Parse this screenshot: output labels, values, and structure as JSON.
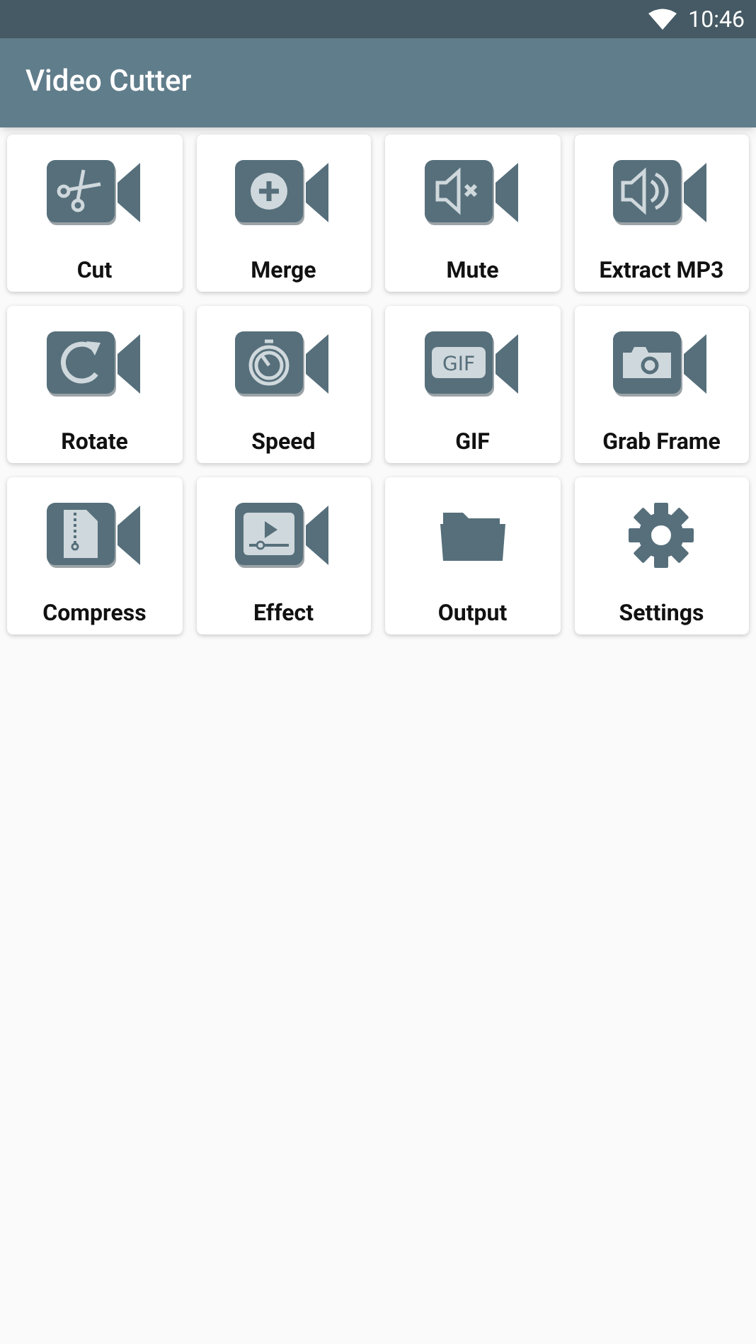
{
  "status_bar": {
    "time": "10:46"
  },
  "app_bar": {
    "title": "Video Cutter"
  },
  "tools": [
    {
      "kind": "cut",
      "label": "Cut"
    },
    {
      "kind": "merge",
      "label": "Merge"
    },
    {
      "kind": "mute",
      "label": "Mute"
    },
    {
      "kind": "extract",
      "label": "Extract MP3"
    },
    {
      "kind": "rotate",
      "label": "Rotate"
    },
    {
      "kind": "speed",
      "label": "Speed"
    },
    {
      "kind": "gif",
      "label": "GIF",
      "icon_text": "GIF"
    },
    {
      "kind": "grab",
      "label": "Grab Frame"
    },
    {
      "kind": "compress",
      "label": "Compress"
    },
    {
      "kind": "effect",
      "label": "Effect"
    },
    {
      "kind": "folder",
      "label": "Output"
    },
    {
      "kind": "gear",
      "label": "Settings"
    }
  ]
}
